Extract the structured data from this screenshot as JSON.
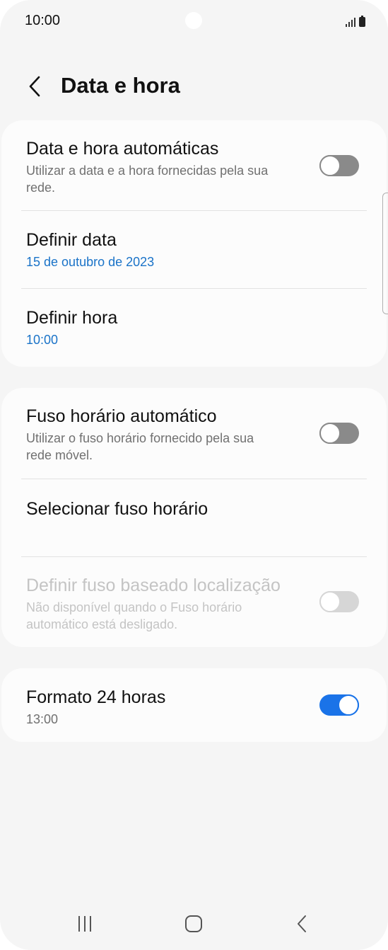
{
  "status_bar": {
    "time": "10:00",
    "icons": [
      "signal-icon",
      "battery-icon"
    ]
  },
  "header": {
    "title": "Data e hora",
    "back_icon": "chevron-left-icon"
  },
  "colors": {
    "accent": "#1a73e8",
    "link": "#1a73c8",
    "background": "#f5f5f5",
    "card": "#fcfcfc",
    "toggle_off": "#8a8a8a"
  },
  "sections": {
    "auto_datetime": {
      "title": "Data e hora automáticas",
      "subtitle_line1": "Utilizar a data e a hora fornecidas pela sua",
      "subtitle_line2": "rede.",
      "enabled": false
    },
    "set_date": {
      "title": "Definir data",
      "value": "15 de outubro de 2023"
    },
    "set_time": {
      "title": "Definir hora",
      "value": "10:00"
    },
    "auto_timezone": {
      "title": "Fuso horário automático",
      "subtitle_line1": "Utilizar o fuso horário fornecido pela sua",
      "subtitle_line2": "rede móvel.",
      "enabled": false
    },
    "select_timezone": {
      "title": "Selecionar fuso horário"
    },
    "location_timezone": {
      "title": "Definir fuso baseado localização",
      "subtitle_line1": "Não disponível quando o Fuso horário",
      "subtitle_line2": "automático está desligado.",
      "enabled": false,
      "disabled": true
    },
    "format_24h": {
      "title": "Formato 24 horas",
      "value": "13:00",
      "enabled": true
    }
  },
  "nav_bar": {
    "recents": "recents-icon",
    "home": "home-icon",
    "back": "back-icon"
  }
}
